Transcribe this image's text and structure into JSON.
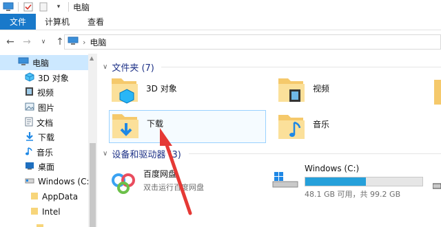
{
  "window": {
    "title": "电脑"
  },
  "ribbon": {
    "tabs": [
      "文件",
      "计算机",
      "查看"
    ]
  },
  "address": {
    "path": "电脑"
  },
  "sidebar": {
    "items": [
      {
        "label": "电脑",
        "icon": "pc-icon"
      },
      {
        "label": "3D 对象",
        "icon": "cube-3d-icon"
      },
      {
        "label": "视频",
        "icon": "video-icon"
      },
      {
        "label": "图片",
        "icon": "pictures-icon"
      },
      {
        "label": "文档",
        "icon": "documents-icon"
      },
      {
        "label": "下载",
        "icon": "download-icon"
      },
      {
        "label": "音乐",
        "icon": "music-icon"
      },
      {
        "label": "桌面",
        "icon": "desktop-icon"
      },
      {
        "label": "Windows (C:)",
        "icon": "drive-icon"
      },
      {
        "label": "AppData",
        "icon": "folder-icon"
      },
      {
        "label": "Intel",
        "icon": "folder-icon"
      }
    ]
  },
  "folders": {
    "header": "文件夹 (7)",
    "items": [
      {
        "label": "3D 对象"
      },
      {
        "label": "视频"
      },
      {
        "label": "下载"
      },
      {
        "label": "音乐"
      }
    ]
  },
  "devices": {
    "header": "设备和驱动器 (3)",
    "netdisk": {
      "name": "百度网盘",
      "sub": "双击运行百度网盘"
    },
    "drive": {
      "name": "Windows (C:)",
      "free_text": "48.1 GB 可用，共 99.2 GB",
      "used_fraction": 0.515
    }
  },
  "colors": {
    "accent": "#1979ca",
    "selection": "#cce8ff",
    "drive_bar": "#26a0da",
    "annotation_arrow": "#e53935"
  }
}
